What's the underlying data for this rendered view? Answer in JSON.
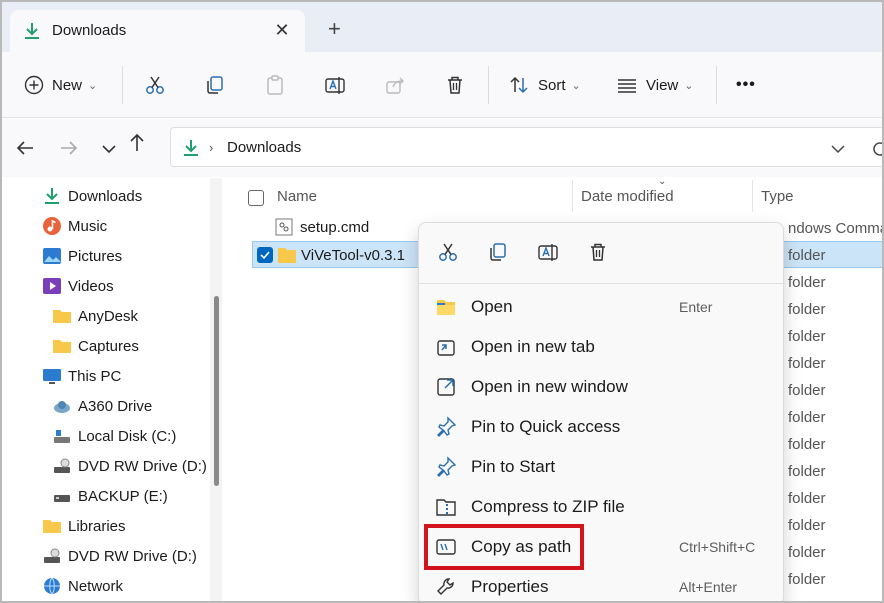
{
  "tab": {
    "title": "Downloads",
    "close": "✕",
    "new": "+"
  },
  "commands": {
    "new_label": "New",
    "sort_label": "Sort",
    "view_label": "View",
    "more": "•••"
  },
  "address": {
    "crumb": "Downloads"
  },
  "sidebar": {
    "items": [
      {
        "label": "Downloads",
        "icon": "download-icon"
      },
      {
        "label": "Music",
        "icon": "music-icon"
      },
      {
        "label": "Pictures",
        "icon": "pictures-icon"
      },
      {
        "label": "Videos",
        "icon": "videos-icon"
      },
      {
        "label": "AnyDesk",
        "icon": "folder-icon"
      },
      {
        "label": "Captures",
        "icon": "folder-icon"
      },
      {
        "label": "This PC",
        "icon": "pc-icon"
      },
      {
        "label": "A360 Drive",
        "icon": "cloud-drive-icon"
      },
      {
        "label": "Local Disk (C:)",
        "icon": "disk-icon"
      },
      {
        "label": "DVD RW Drive (D:)",
        "icon": "dvd-icon"
      },
      {
        "label": "BACKUP (E:)",
        "icon": "drive-icon"
      },
      {
        "label": "Libraries",
        "icon": "library-icon"
      },
      {
        "label": "DVD RW Drive (D:)",
        "icon": "dvd-icon"
      },
      {
        "label": "Network",
        "icon": "network-icon"
      }
    ]
  },
  "filelist": {
    "columns": {
      "name": "Name",
      "date": "Date modified",
      "type": "Type"
    },
    "rows": [
      {
        "name": "setup.cmd",
        "type": "ndows Comma..."
      },
      {
        "name": "ViVeTool-v0.3.1",
        "type": "folder"
      }
    ],
    "type_cells": [
      "folder",
      "folder",
      "folder",
      "folder",
      "folder",
      "folder",
      "folder",
      "folder",
      "folder",
      "folder",
      "folder",
      "folder"
    ]
  },
  "context_menu": {
    "items": [
      {
        "label": "Open",
        "shortcut": "Enter",
        "icon": "folder-open-icon"
      },
      {
        "label": "Open in new tab",
        "shortcut": "",
        "icon": "new-tab-icon"
      },
      {
        "label": "Open in new window",
        "shortcut": "",
        "icon": "new-window-icon"
      },
      {
        "label": "Pin to Quick access",
        "shortcut": "",
        "icon": "pin-icon"
      },
      {
        "label": "Pin to Start",
        "shortcut": "",
        "icon": "pin-icon"
      },
      {
        "label": "Compress to ZIP file",
        "shortcut": "",
        "icon": "zip-icon"
      },
      {
        "label": "Copy as path",
        "shortcut": "Ctrl+Shift+C",
        "icon": "copy-path-icon"
      },
      {
        "label": "Properties",
        "shortcut": "Alt+Enter",
        "icon": "properties-icon"
      }
    ]
  },
  "colors": {
    "accent": "#0067c0",
    "selection": "#cce4f7",
    "highlight": "#d2141c",
    "folder": "#f8c84a"
  }
}
